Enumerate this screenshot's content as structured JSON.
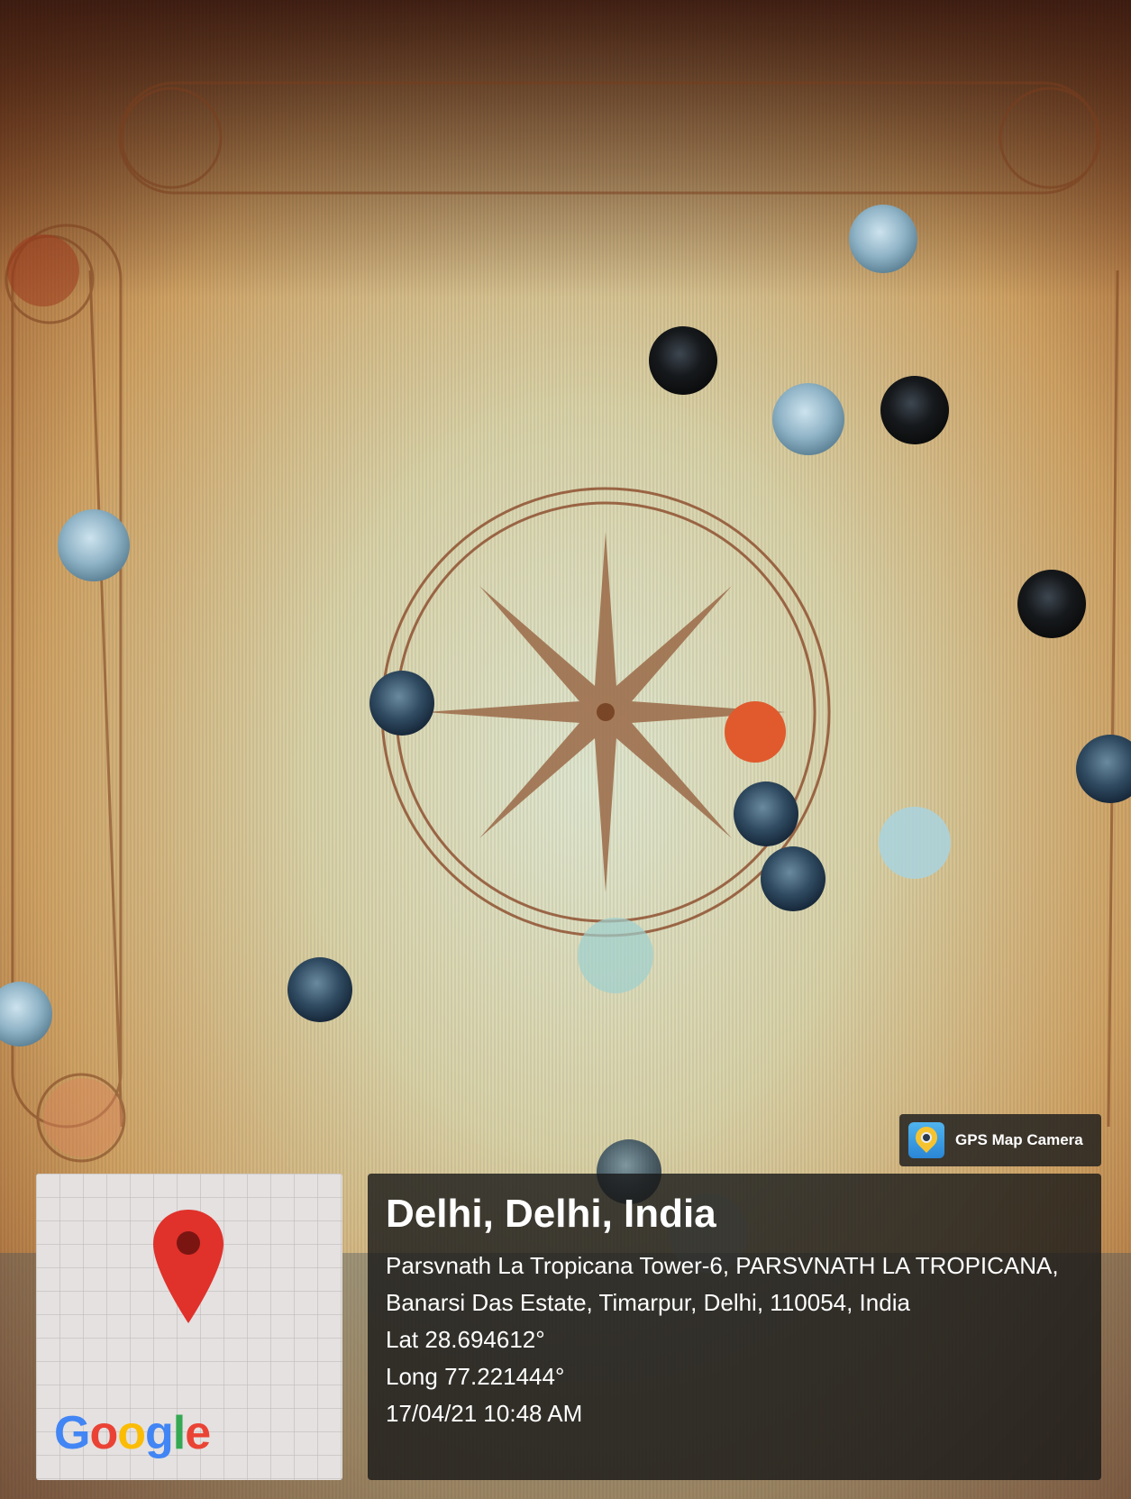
{
  "badge": {
    "label": "GPS Map Camera",
    "icon": "gps-map-camera-app-icon"
  },
  "map_thumbnail": {
    "logo_text": "Google",
    "logo_colors": [
      "#4285F4",
      "#EA4335",
      "#FBBC05",
      "#4285F4",
      "#34A853",
      "#EA4335"
    ],
    "pin_color": "#E0312B",
    "icon": "map-pin-icon"
  },
  "location": {
    "title": "Delhi, Delhi, India",
    "address": "Parsvnath La Tropicana Tower-6, PARSVNATH LA TROPICANA, Banarsi Das Estate, Timarpur, Delhi, 110054, India",
    "latitude": "Lat 28.694612°",
    "longitude": "Long 77.221444°",
    "timestamp": "17/04/21 10:48 AM"
  },
  "scene": {
    "description_icon": "carrom-board-photo",
    "board_color": "#d2ad74",
    "coin_colors": {
      "black": "#1a1c1e",
      "white": "#8fb3c6",
      "queen": "#e05a2e"
    }
  }
}
